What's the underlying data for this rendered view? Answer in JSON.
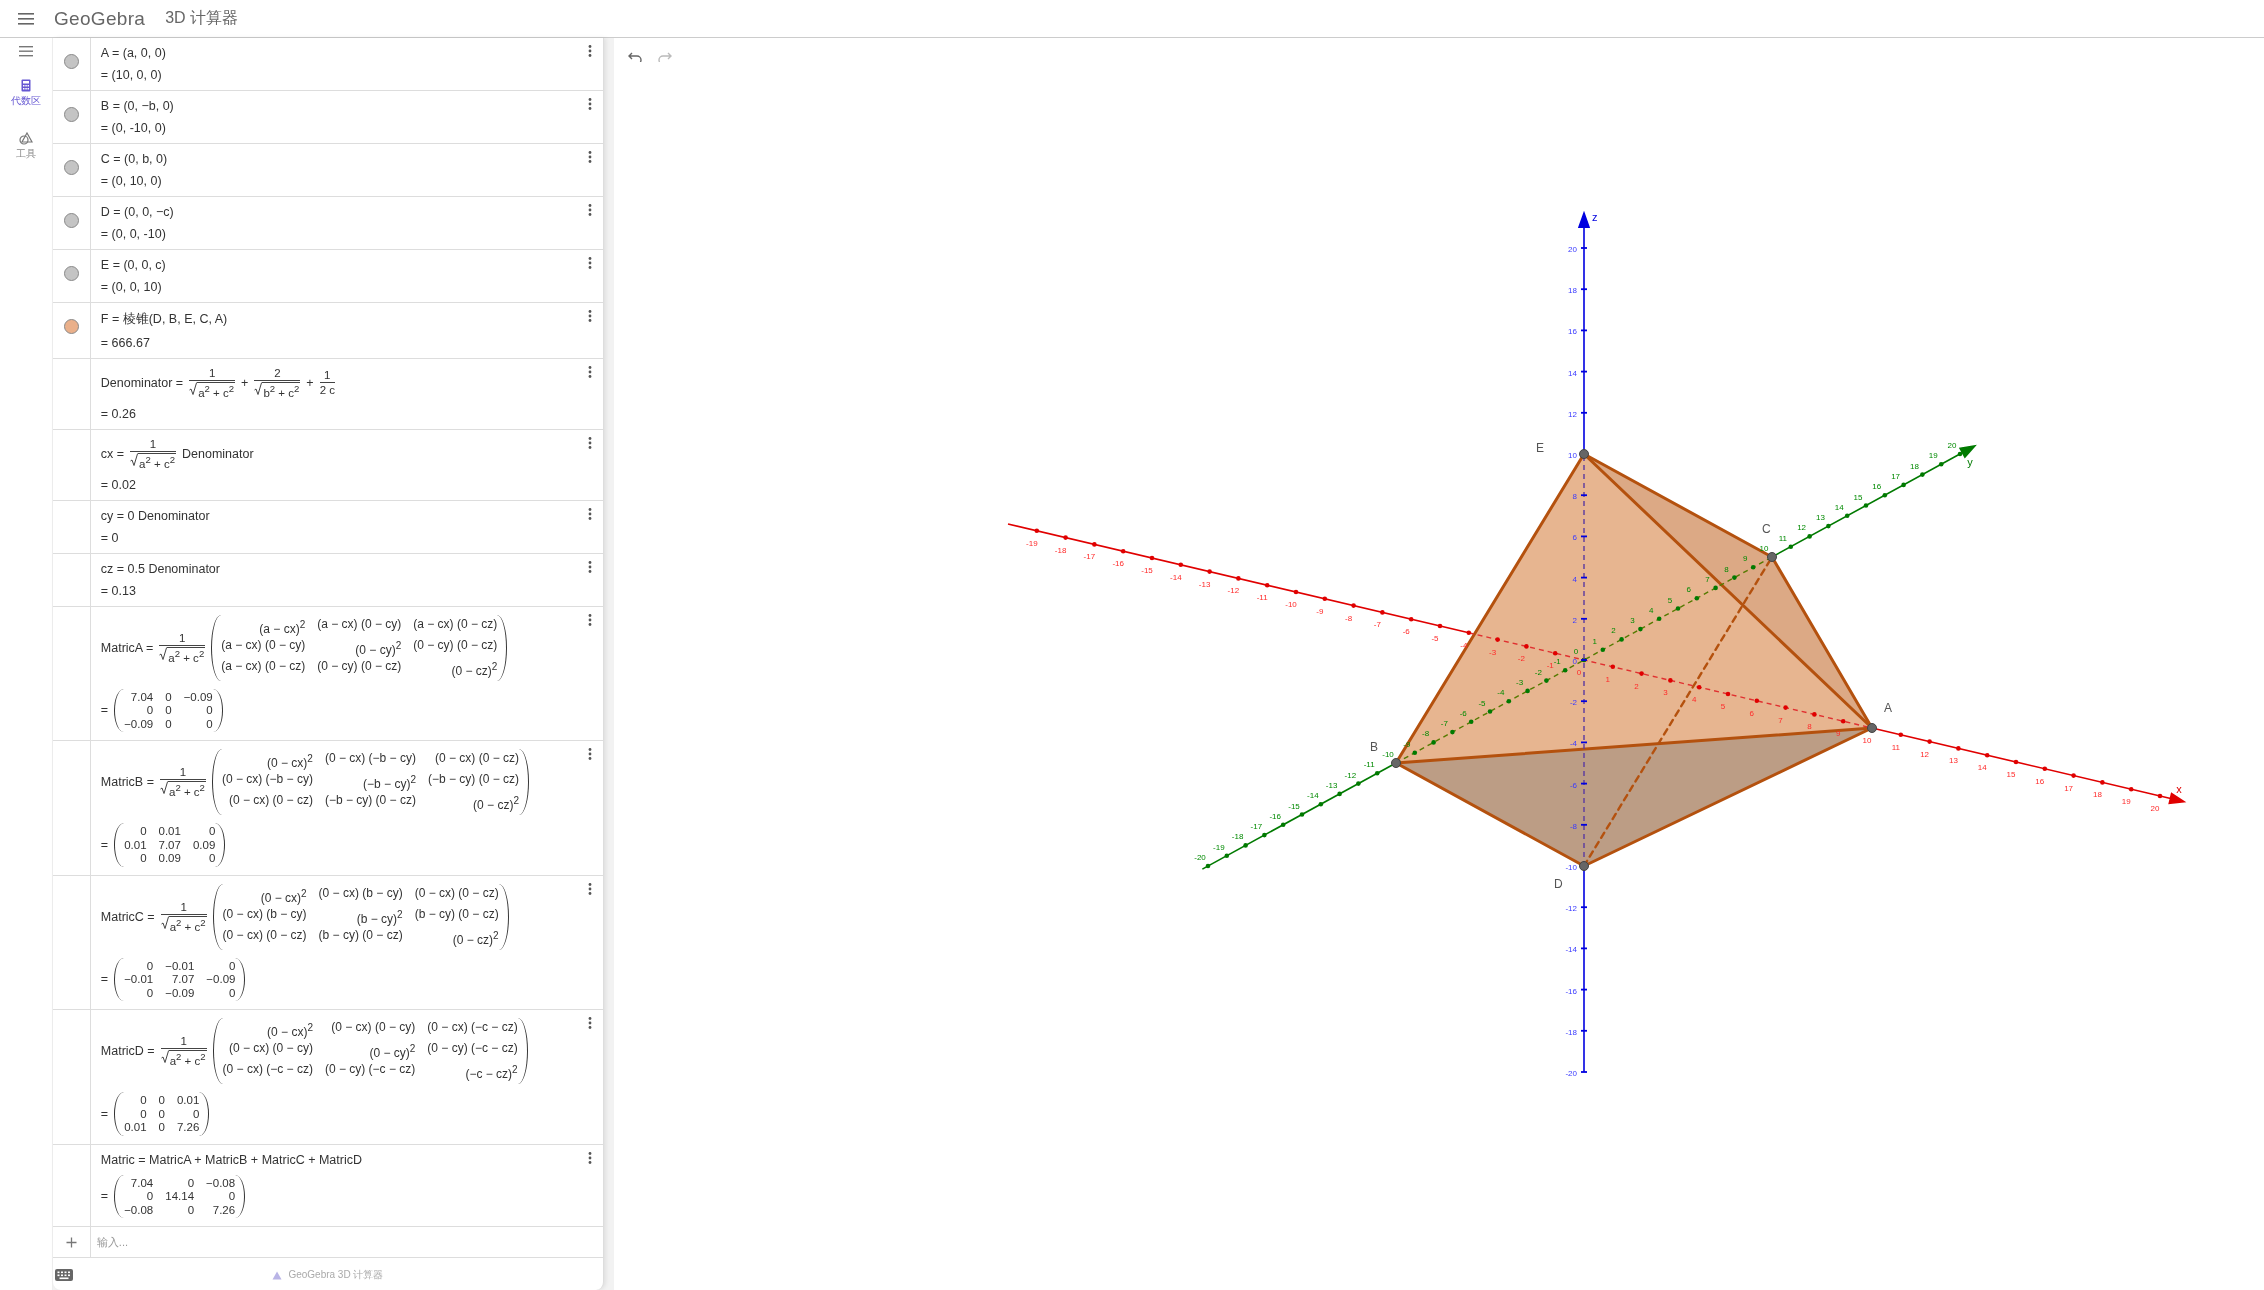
{
  "header": {
    "logo": "GeoGebra",
    "title": "3D 计算器"
  },
  "sidebar": {
    "tabs": [
      {
        "label": "代数区",
        "selected": true
      },
      {
        "label": "工具",
        "selected": false
      }
    ]
  },
  "algebra": {
    "items": [
      {
        "color": "#c4c4c4",
        "definition": [
          {
            "kind": "text",
            "s": "A = (a, 0, 0)"
          }
        ],
        "value": [
          {
            "kind": "text",
            "s": "= (10, 0, 0)"
          }
        ]
      },
      {
        "color": "#c4c4c4",
        "definition": [
          {
            "kind": "text",
            "s": "B = (0, −b, 0)"
          }
        ],
        "value": [
          {
            "kind": "text",
            "s": "= (0, -10, 0)"
          }
        ]
      },
      {
        "color": "#c4c4c4",
        "definition": [
          {
            "kind": "text",
            "s": "C = (0, b, 0)"
          }
        ],
        "value": [
          {
            "kind": "text",
            "s": "= (0, 10, 0)"
          }
        ]
      },
      {
        "color": "#c4c4c4",
        "definition": [
          {
            "kind": "text",
            "s": "D = (0, 0, −c)"
          }
        ],
        "value": [
          {
            "kind": "text",
            "s": "= (0, 0, -10)"
          }
        ]
      },
      {
        "color": "#c4c4c4",
        "definition": [
          {
            "kind": "text",
            "s": "E = (0, 0, c)"
          }
        ],
        "value": [
          {
            "kind": "text",
            "s": "= (0, 0, 10)"
          }
        ]
      },
      {
        "color": "#eab08a",
        "definition": [
          {
            "kind": "text",
            "s": "F = 棱锥(D, B, E, C, A)"
          }
        ],
        "value": [
          {
            "kind": "text",
            "s": "= 666.67"
          }
        ]
      },
      {
        "definition": [
          {
            "kind": "text",
            "s": "Denominator ="
          },
          {
            "kind": "frac",
            "num": "1",
            "den": "a$^{2}$ + c$^{2}$",
            "root": true
          },
          {
            "kind": "text",
            "s": "+"
          },
          {
            "kind": "frac",
            "num": "2",
            "den": "b$^{2}$ + c$^{2}$",
            "root": true
          },
          {
            "kind": "text",
            "s": "+"
          },
          {
            "kind": "frac",
            "num": "1",
            "den": "2 c",
            "root": false
          }
        ],
        "value": [
          {
            "kind": "text",
            "s": "= 0.26"
          }
        ]
      },
      {
        "definition": [
          {
            "kind": "text",
            "s": "cx ="
          },
          {
            "kind": "frac",
            "num": "1",
            "den": "a$^{2}$ + c$^{2}$",
            "root": true
          },
          {
            "kind": "text",
            "s": "Denominator"
          }
        ],
        "value": [
          {
            "kind": "text",
            "s": "= 0.02"
          }
        ]
      },
      {
        "definition": [
          {
            "kind": "text",
            "s": "cy = 0 Denominator"
          }
        ],
        "value": [
          {
            "kind": "text",
            "s": "= 0"
          }
        ]
      },
      {
        "definition": [
          {
            "kind": "text",
            "s": "cz = 0.5 Denominator"
          }
        ],
        "value": [
          {
            "kind": "text",
            "s": "= 0.13"
          }
        ]
      },
      {
        "definition": [
          {
            "kind": "text",
            "s": "MatricA ="
          },
          {
            "kind": "frac",
            "num": "1",
            "den": "a$^{2}$ + c$^{2}$",
            "root": true
          },
          {
            "kind": "matrix",
            "rows": [
              [
                "(a − cx)$^{2}$",
                "(a − cx) (0 − cy)",
                "(a − cx) (0 − cz)"
              ],
              [
                "(a − cx) (0 − cy)",
                "(0 − cy)$^{2}$",
                "(0 − cy) (0 − cz)"
              ],
              [
                "(a − cx) (0 − cz)",
                "(0 − cy) (0 − cz)",
                "(0 − cz)$^{2}$"
              ]
            ]
          }
        ],
        "value": [
          {
            "kind": "text",
            "s": "="
          },
          {
            "kind": "matrix",
            "rows": [
              [
                "7.04",
                "0",
                "−0.09"
              ],
              [
                "0",
                "0",
                "0"
              ],
              [
                "−0.09",
                "0",
                "0"
              ]
            ]
          }
        ]
      },
      {
        "definition": [
          {
            "kind": "text",
            "s": "MatricB ="
          },
          {
            "kind": "frac",
            "num": "1",
            "den": "a$^{2}$ + c$^{2}$",
            "root": true
          },
          {
            "kind": "matrix",
            "rows": [
              [
                "(0 − cx)$^{2}$",
                "(0 − cx) (−b − cy)",
                "(0 − cx) (0 − cz)"
              ],
              [
                "(0 − cx) (−b − cy)",
                "(−b − cy)$^{2}$",
                "(−b − cy) (0 − cz)"
              ],
              [
                "(0 − cx) (0 − cz)",
                "(−b − cy) (0 − cz)",
                "(0 − cz)$^{2}$"
              ]
            ]
          }
        ],
        "value": [
          {
            "kind": "text",
            "s": "="
          },
          {
            "kind": "matrix",
            "rows": [
              [
                "0",
                "0.01",
                "0"
              ],
              [
                "0.01",
                "7.07",
                "0.09"
              ],
              [
                "0",
                "0.09",
                "0"
              ]
            ]
          }
        ]
      },
      {
        "definition": [
          {
            "kind": "text",
            "s": "MatricC ="
          },
          {
            "kind": "frac",
            "num": "1",
            "den": "a$^{2}$ + c$^{2}$",
            "root": true
          },
          {
            "kind": "matrix",
            "rows": [
              [
                "(0 − cx)$^{2}$",
                "(0 − cx) (b − cy)",
                "(0 − cx) (0 − cz)"
              ],
              [
                "(0 − cx) (b − cy)",
                "(b − cy)$^{2}$",
                "(b − cy) (0 − cz)"
              ],
              [
                "(0 − cx) (0 − cz)",
                "(b − cy) (0 − cz)",
                "(0 − cz)$^{2}$"
              ]
            ]
          }
        ],
        "value": [
          {
            "kind": "text",
            "s": "="
          },
          {
            "kind": "matrix",
            "rows": [
              [
                "0",
                "−0.01",
                "0"
              ],
              [
                "−0.01",
                "7.07",
                "−0.09"
              ],
              [
                "0",
                "−0.09",
                "0"
              ]
            ]
          }
        ]
      },
      {
        "definition": [
          {
            "kind": "text",
            "s": "MatricD ="
          },
          {
            "kind": "frac",
            "num": "1",
            "den": "a$^{2}$ + c$^{2}$",
            "root": true
          },
          {
            "kind": "matrix",
            "rows": [
              [
                "(0 − cx)$^{2}$",
                "(0 − cx) (0 − cy)",
                "(0 − cx) (−c − cz)"
              ],
              [
                "(0 − cx) (0 − cy)",
                "(0 − cy)$^{2}$",
                "(0 − cy) (−c − cz)"
              ],
              [
                "(0 − cx) (−c − cz)",
                "(0 − cy) (−c − cz)",
                "(−c − cz)$^{2}$"
              ]
            ]
          }
        ],
        "value": [
          {
            "kind": "text",
            "s": "="
          },
          {
            "kind": "matrix",
            "rows": [
              [
                "0",
                "0",
                "0.01"
              ],
              [
                "0",
                "0",
                "0"
              ],
              [
                "0.01",
                "0",
                "7.26"
              ]
            ]
          }
        ]
      },
      {
        "definition": [
          {
            "kind": "text",
            "s": "Matric = MatricA + MatricB + MatricC + MatricD"
          }
        ],
        "value": [
          {
            "kind": "text",
            "s": "="
          },
          {
            "kind": "matrix",
            "rows": [
              [
                "7.04",
                "0",
                "−0.08"
              ],
              [
                "0",
                "14.14",
                "0"
              ],
              [
                "−0.08",
                "0",
                "7.26"
              ]
            ]
          }
        ]
      }
    ],
    "input": {
      "placeholder": "输入..."
    },
    "footer": "GeoGebra 3D 计算器"
  },
  "graphics": {
    "points": [
      {
        "label": "A"
      },
      {
        "label": "B"
      },
      {
        "label": "C"
      },
      {
        "label": "D"
      },
      {
        "label": "E"
      }
    ],
    "axes": [
      {
        "kind": "x",
        "label": "x",
        "ticks": [
          "-19",
          "-18",
          "-17",
          "-16",
          "-15",
          "-14",
          "-13",
          "-12",
          "-11",
          "-10",
          "-9",
          "-8",
          "-7",
          "-6",
          "-5",
          "-4",
          "-3",
          "-2",
          "-1",
          "0",
          "1",
          "2",
          "3",
          "4",
          "5",
          "6",
          "7",
          "8",
          "9",
          "10",
          "11",
          "12",
          "13",
          "14",
          "15",
          "16",
          "17",
          "18",
          "19",
          "20"
        ]
      },
      {
        "kind": "y",
        "label": "y",
        "ticks": [
          "-20",
          "-19",
          "-18",
          "-17",
          "-16",
          "-15",
          "-14",
          "-13",
          "-12",
          "-11",
          "-10",
          "-9",
          "-8",
          "-7",
          "-6",
          "-5",
          "-4",
          "-3",
          "-2",
          "-1",
          "0",
          "1",
          "2",
          "3",
          "4",
          "5",
          "6",
          "7",
          "8",
          "9",
          "10",
          "11",
          "12",
          "13",
          "14",
          "15",
          "16",
          "17",
          "18",
          "19",
          "20"
        ]
      },
      {
        "kind": "z",
        "label": "z",
        "ticks": [
          "20",
          "18",
          "16",
          "14",
          "12",
          "10",
          "8",
          "6",
          "4",
          "2",
          "0",
          "-2",
          "-4",
          "-6",
          "-8",
          "-10",
          "-12",
          "-14",
          "-16",
          "-18",
          "-20"
        ]
      }
    ]
  }
}
